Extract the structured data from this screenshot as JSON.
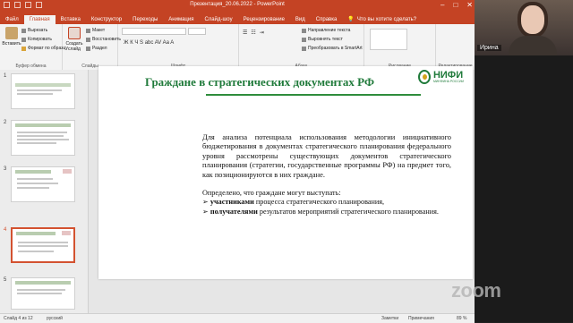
{
  "window": {
    "title": "Презентация_20.06.2022 - PowerPoint",
    "colors": {
      "accent": "#c44324",
      "slide_title": "#1f7a3a"
    }
  },
  "ribbon_tabs": [
    "Файл",
    "Главная",
    "Вставка",
    "Конструктор",
    "Переходы",
    "Анимация",
    "Слайд-шоу",
    "Рецензирование",
    "Вид",
    "Справка"
  ],
  "tell_me": "Что вы хотите сделать?",
  "ribbon": {
    "clipboard": {
      "paste": "Вставить",
      "cut": "Вырезать",
      "copy": "Копировать",
      "format_painter": "Формат по образцу",
      "label": "Буфер обмена"
    },
    "slides": {
      "new_slide": "Создать слайд",
      "layout": "Макет",
      "reset": "Восстановить",
      "section": "Раздел",
      "label": "Слайды"
    },
    "font": {
      "label": "Шрифт",
      "format_buttons": "Ж К Ч S abc AV Aa A"
    },
    "paragraph": {
      "label": "Абзац",
      "direction": "Направление текста",
      "align": "Выровнять текст",
      "smartart": "Преобразовать в SmartArt"
    },
    "drawing": {
      "label": "Рисование"
    },
    "editing": {
      "label": "Редактирование"
    }
  },
  "slide_numbers": [
    "1",
    "2",
    "3",
    "4",
    "5"
  ],
  "slide": {
    "title": "Граждане в стратегических документах РФ",
    "logo": "НИФИ",
    "logo_sub": "МИНФИНА РОССИИ",
    "paragraph1": "Для анализа потенциала использования методологии инициативного бюджетирования в документах стратегического планирования федерального уровня рассмотрены существующих документов стратегического планирования (стратегии, государственные программы РФ) на предмет того, как позиционируются в них граждане.",
    "paragraph2": "Определено, что граждане могут выступать:",
    "bullet1_bold": "участниками",
    "bullet1_rest": " процесса стратегического планирования,",
    "bullet2_bold": "получателями",
    "bullet2_rest": " результатов мероприятий стратегического планирования.",
    "bullet_marker": "➢"
  },
  "statusbar": {
    "slide_count": "Слайд 4 из 12",
    "language": "русский",
    "notes": "Заметки",
    "comments": "Примечания",
    "zoom": "89 %"
  },
  "zoom_app": {
    "participant": "Ирина",
    "watermark": "zoom"
  }
}
